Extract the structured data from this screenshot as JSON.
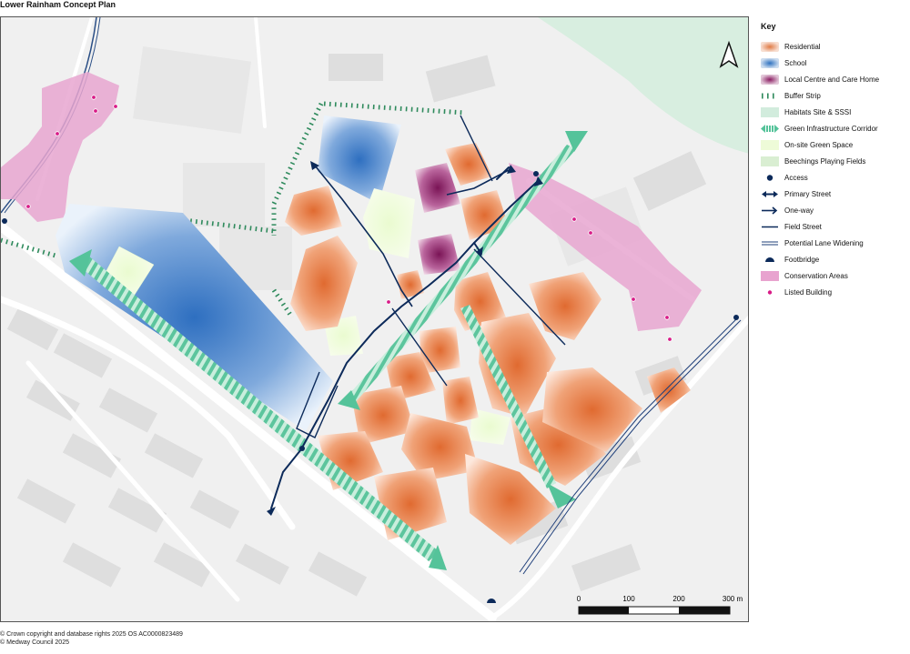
{
  "title": "Lower Rainham Concept Plan",
  "key": {
    "title": "Key",
    "items": [
      {
        "label": "Residential",
        "symbol": "residential",
        "color": "#e07a45"
      },
      {
        "label": "School",
        "symbol": "school",
        "color": "#2f72c0"
      },
      {
        "label": "Local Centre and Care Home",
        "symbol": "local-centre",
        "color": "#8a1c62"
      },
      {
        "label": "Buffer Strip",
        "symbol": "buffer-strip",
        "color": "#2e8a5c"
      },
      {
        "label": "Habitats Site & SSSI",
        "symbol": "habitats",
        "color": "#d2ecdd"
      },
      {
        "label": "Green Infrastructure Corridor",
        "symbol": "gi-corridor",
        "color": "#55c39a"
      },
      {
        "label": "On-site Green Space",
        "symbol": "green-space",
        "color": "#eefbd8"
      },
      {
        "label": "Beechings Playing Fields",
        "symbol": "playing-fields",
        "color": "#d9eed2"
      },
      {
        "label": "Access",
        "symbol": "access",
        "color": "#0c2a5a"
      },
      {
        "label": "Primary Street",
        "symbol": "primary-street",
        "color": "#0c2a5a"
      },
      {
        "label": "One-way",
        "symbol": "one-way",
        "color": "#0c2a5a"
      },
      {
        "label": "Field Street",
        "symbol": "field-street",
        "color": "#0c2a5a"
      },
      {
        "label": "Potential Lane Widening",
        "symbol": "lane-widening",
        "color": "#1f3f7a"
      },
      {
        "label": "Footbridge",
        "symbol": "footbridge",
        "color": "#0c2a5a"
      },
      {
        "label": "Conservation Areas",
        "symbol": "conservation",
        "color": "#e8a3cf"
      },
      {
        "label": "Listed Building",
        "symbol": "listed-building",
        "color": "#d81b87"
      }
    ]
  },
  "scale_bar": {
    "labels": [
      "0",
      "100",
      "200",
      "300 m"
    ]
  },
  "north_arrow": "north-arrow-icon",
  "footer": {
    "line1": "© Crown copyright and database rights 2025 OS AC0000823489",
    "line2": "© Medway Council 2025"
  }
}
